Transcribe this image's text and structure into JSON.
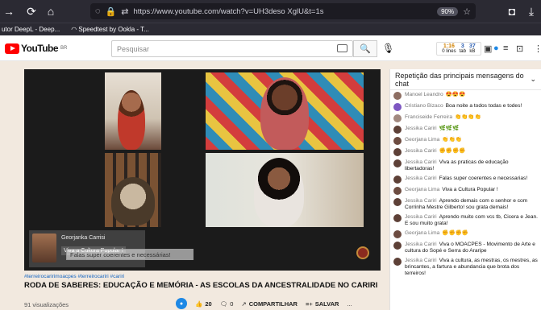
{
  "browser": {
    "url": "https://www.youtube.com/watch?v=UH3deso XglU&t=1s",
    "zoom": "90%",
    "bookmarks": [
      "utor DeepL - Deep...",
      "Speedtest by Ookla - T..."
    ]
  },
  "youtube": {
    "logo_text": "YouTube",
    "logo_sup": "BR",
    "search_placeholder": "Pesquisar",
    "stats": [
      {
        "num": "1:16",
        "label": "0 lines"
      },
      {
        "num": "3",
        "label": "tab"
      },
      {
        "num": "37",
        "label": "kB"
      }
    ]
  },
  "video": {
    "lower_third_name": "Georjanka Carrisi",
    "lower_third_message": "Viva a Cultura Popular !",
    "overlay_message": "Falas super coerentes e necessárias!"
  },
  "info": {
    "hashtags": "#terreirocaririmoacpes #terreirocariri #cariri",
    "title": "RODA DE SABERES: EDUCAÇÃO E MEMÓRIA - AS ESCOLAS DA ANCESTRALIDADE NO CARIRI",
    "views": "91 visualizações",
    "likes": "20",
    "dislikes": "0",
    "share_label": "COMPARTILHAR",
    "save_label": "SALVAR",
    "more_label": "..."
  },
  "chat": {
    "header": "Repetição das principais mensagens do chat",
    "messages": [
      {
        "author": "Manoel Leandro",
        "text": "😍😍😍",
        "color": "#8d6e63"
      },
      {
        "author": "Cristiano Bizaco",
        "text": "Boa noite a todos todas e todes!",
        "color": "#7e57c2"
      },
      {
        "author": "Franciseide Ferreira",
        "text": "👏👏👏👏",
        "color": "#a1887f"
      },
      {
        "author": "Jessika Cariri",
        "text": "🌿🌿🌿",
        "color": "#5d4037"
      },
      {
        "author": "Georjana Lima",
        "text": "👏👏👏",
        "color": "#6d4c41"
      },
      {
        "author": "Jessika Cariri",
        "text": "✊✊✊✊",
        "color": "#5d4037"
      },
      {
        "author": "Jessika Cariri",
        "text": "Viva as praticas de educação libertadoras!",
        "color": "#5d4037"
      },
      {
        "author": "Jessika Cariri",
        "text": "Falas super coerentes e necessarias!",
        "color": "#5d4037"
      },
      {
        "author": "Georjana Lima",
        "text": "Viva a Cultura Popular !",
        "color": "#6d4c41"
      },
      {
        "author": "Jessika Cariri",
        "text": "Aprendo demais com o senhor e com Corrinha Mestre Gilberto! sou grata demais!",
        "color": "#5d4037"
      },
      {
        "author": "Jessika Cariri",
        "text": "Aprendo muito com vcs tb, Cicera e Jean. E sou muito grata!",
        "color": "#5d4037"
      },
      {
        "author": "Georjana Lima",
        "text": "✊✊✊✊",
        "color": "#6d4c41"
      },
      {
        "author": "Jessika Cariri",
        "text": "Viva o MOACPES - Movimento de Arte e cultura do Sopé e Serra do Araripe",
        "color": "#5d4037"
      },
      {
        "author": "Jessika Cariri",
        "text": "Viva a cultura, as mestras, os mestres, as brincantes, a fartura e abundancia que brota dos terreiros!",
        "color": "#5d4037"
      }
    ]
  }
}
